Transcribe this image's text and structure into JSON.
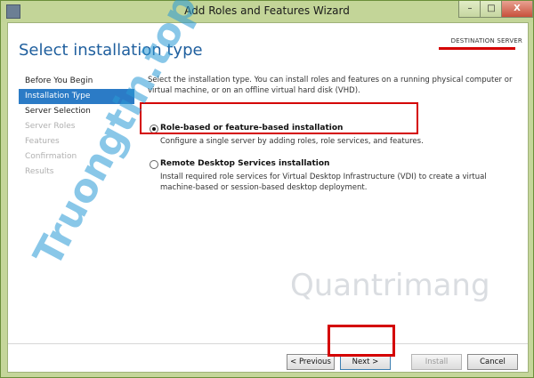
{
  "window": {
    "title": "Add Roles and Features Wizard"
  },
  "titlebar_buttons": {
    "minimize": "–",
    "maximize": "□",
    "close": "X"
  },
  "header": {
    "page_title": "Select installation type",
    "destination_label": "DESTINATION SERVER"
  },
  "nav": {
    "items": [
      {
        "label": "Before You Begin",
        "state": "normal"
      },
      {
        "label": "Installation Type",
        "state": "active"
      },
      {
        "label": "Server Selection",
        "state": "normal"
      },
      {
        "label": "Server Roles",
        "state": "disabled"
      },
      {
        "label": "Features",
        "state": "disabled"
      },
      {
        "label": "Confirmation",
        "state": "disabled"
      },
      {
        "label": "Results",
        "state": "disabled"
      }
    ]
  },
  "content": {
    "intro": "Select the installation type. You can install roles and features on a running physical computer or virtual machine, or on an offline virtual hard disk (VHD).",
    "options": [
      {
        "title": "Role-based or feature-based installation",
        "desc": "Configure a single server by adding roles, role services, and features.",
        "selected": true
      },
      {
        "title": "Remote Desktop Services installation",
        "desc": "Install required role services for Virtual Desktop Infrastructure (VDI) to create a virtual machine-based or session-based desktop deployment.",
        "selected": false
      }
    ]
  },
  "footer": {
    "previous": "< Previous",
    "next": "Next >",
    "install": "Install",
    "cancel": "Cancel"
  },
  "watermarks": {
    "left": "Truongtin.top",
    "logo": "Quantrimang"
  },
  "colors": {
    "accent": "#2b7bc6",
    "title_blue": "#1f5f9e",
    "highlight_red": "#d40000",
    "chrome_green": "#c5d69a"
  }
}
